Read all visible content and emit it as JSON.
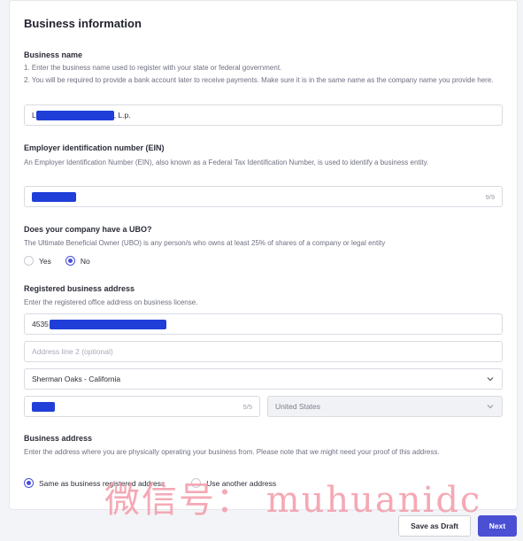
{
  "section_title": "Business information",
  "business_name": {
    "label": "Business name",
    "desc_1": "1. Enter the business name used to register with your state or federal government.",
    "desc_2": "2. You will be required to provide a bank account later to receive payments. Make sure it is in the same name as the company name you provide here.",
    "value_prefix": "L",
    "value_suffix": ", L.p."
  },
  "ein": {
    "label": "Employer identification number (EIN)",
    "desc": "An Employer Identification Number (EIN), also known as a Federal Tax Identification Number, is used to identify a business entity.",
    "counter": "9/9"
  },
  "ubo": {
    "label": "Does your company have a UBO?",
    "desc": "The Ultimate Beneficial Owner (UBO) is any person/s who owns at least 25% of shares of a company or legal entity",
    "options": [
      "Yes",
      "No"
    ],
    "selected": "No"
  },
  "registered_address": {
    "label": "Registered business address",
    "desc": "Enter the registered office address on business license.",
    "line1_prefix": "4535",
    "line2_placeholder": "Address line 2 (optional)",
    "city_state": "Sherman Oaks - California",
    "zip_counter": "5/5",
    "country": "United States"
  },
  "business_address": {
    "label": "Business address",
    "desc": "Enter the address where you are physically operating your business from. Please note that we might need your proof of this address.",
    "options": [
      "Same as business registered address",
      "Use another address"
    ],
    "selected": "Same as business registered address"
  },
  "footer": {
    "save_draft": "Save as Draft",
    "next": "Next"
  },
  "watermark": "微信号： muhuanidc",
  "colors": {
    "accent": "#4b4fd4",
    "redaction": "#1f3fd8"
  }
}
